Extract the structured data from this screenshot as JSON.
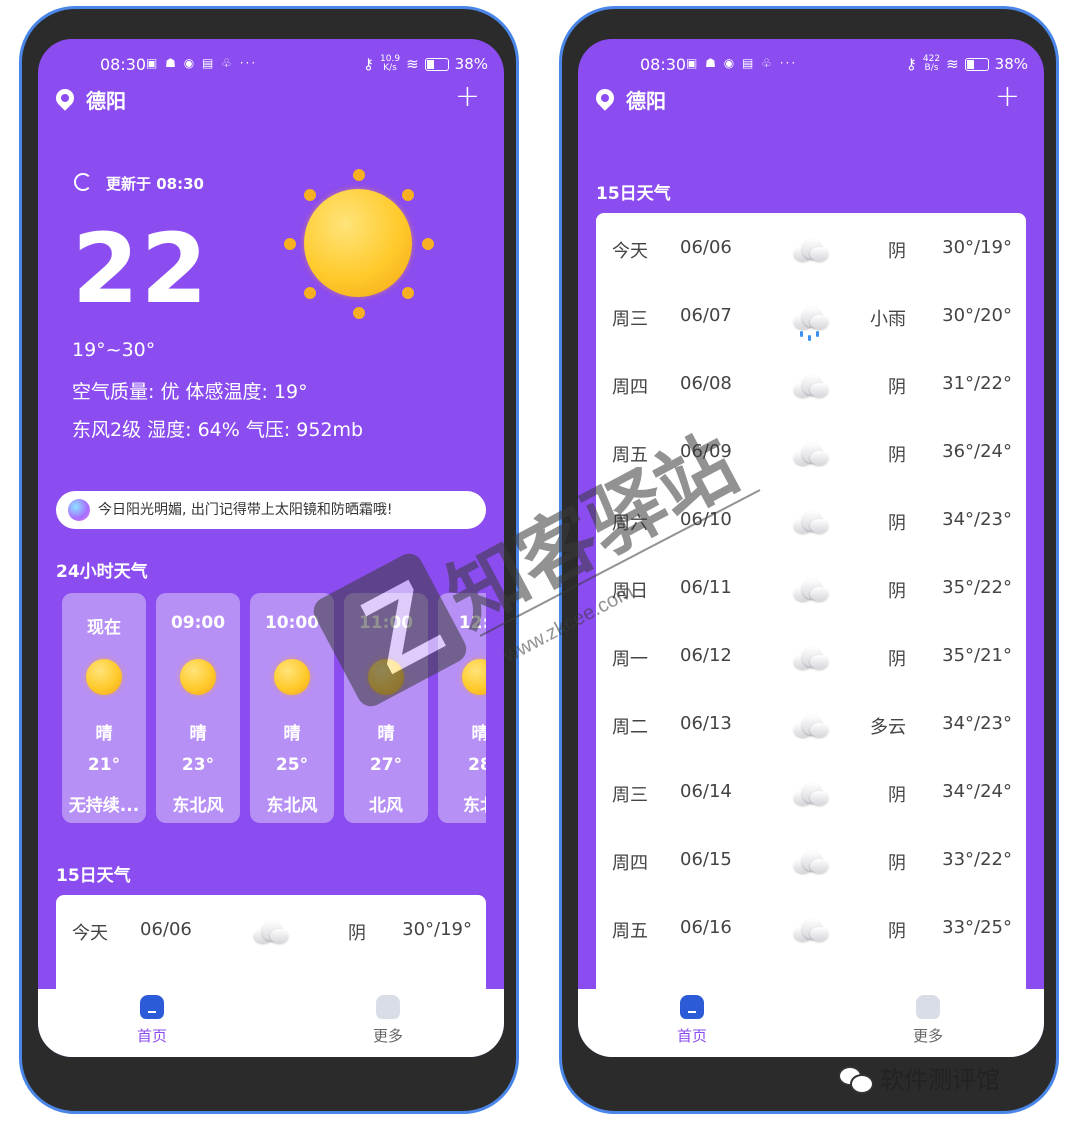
{
  "colors": {
    "screen_bg": "#8b4cf0",
    "frame_border": "#4a86e8",
    "nav_active": "#2c5bd8"
  },
  "status": {
    "time": "08:30",
    "dots": "···",
    "battery": "38%",
    "left_speed": {
      "value": "10.9",
      "unit": "K/s"
    },
    "right_speed": {
      "value": "422",
      "unit": "B/s"
    }
  },
  "city": "德阳",
  "add_icon": "+",
  "hero": {
    "updated": "更新于 08:30",
    "temperature": "22",
    "range": "19°~30°",
    "line1": "空气质量: 优  体感温度: 19°",
    "line2": "东风2级    湿度: 64%    气压: 952mb"
  },
  "tip": "今日阳光明媚, 出门记得带上太阳镜和防晒霜哦!",
  "hourly_title": "24小时天气",
  "hourly": [
    {
      "time": "现在",
      "cond": "晴",
      "temp": "21°",
      "wind": "无持续..."
    },
    {
      "time": "09:00",
      "cond": "晴",
      "temp": "23°",
      "wind": "东北风"
    },
    {
      "time": "10:00",
      "cond": "晴",
      "temp": "25°",
      "wind": "东北风"
    },
    {
      "time": "11:00",
      "cond": "晴",
      "temp": "27°",
      "wind": "北风"
    },
    {
      "time": "12:0",
      "cond": "晴",
      "temp": "28",
      "wind": "东北"
    }
  ],
  "daily_title": "15日天气",
  "daily": [
    {
      "weekday": "今天",
      "date": "06/06",
      "cond": "阴",
      "temp": "30°/19°",
      "icon": "cloud-icon"
    },
    {
      "weekday": "周三",
      "date": "06/07",
      "cond": "小雨",
      "temp": "30°/20°",
      "icon": "rain-cloud-icon"
    },
    {
      "weekday": "周四",
      "date": "06/08",
      "cond": "阴",
      "temp": "31°/22°",
      "icon": "cloud-icon"
    },
    {
      "weekday": "周五",
      "date": "06/09",
      "cond": "阴",
      "temp": "36°/24°",
      "icon": "cloud-icon"
    },
    {
      "weekday": "周六",
      "date": "06/10",
      "cond": "阴",
      "temp": "34°/23°",
      "icon": "cloud-icon"
    },
    {
      "weekday": "周日",
      "date": "06/11",
      "cond": "阴",
      "temp": "35°/22°",
      "icon": "cloud-icon"
    },
    {
      "weekday": "周一",
      "date": "06/12",
      "cond": "阴",
      "temp": "35°/21°",
      "icon": "cloud-icon"
    },
    {
      "weekday": "周二",
      "date": "06/13",
      "cond": "多云",
      "temp": "34°/23°",
      "icon": "cloud-icon"
    },
    {
      "weekday": "周三",
      "date": "06/14",
      "cond": "阴",
      "temp": "34°/24°",
      "icon": "cloud-icon"
    },
    {
      "weekday": "周四",
      "date": "06/15",
      "cond": "阴",
      "temp": "33°/22°",
      "icon": "cloud-icon"
    },
    {
      "weekday": "周五",
      "date": "06/16",
      "cond": "阴",
      "temp": "33°/25°",
      "icon": "cloud-icon"
    }
  ],
  "nav": {
    "home": "首页",
    "more": "更多"
  },
  "watermark": "软件测评馆",
  "overlay": {
    "text": "知客驿站",
    "url": "www.zkcee.com"
  }
}
